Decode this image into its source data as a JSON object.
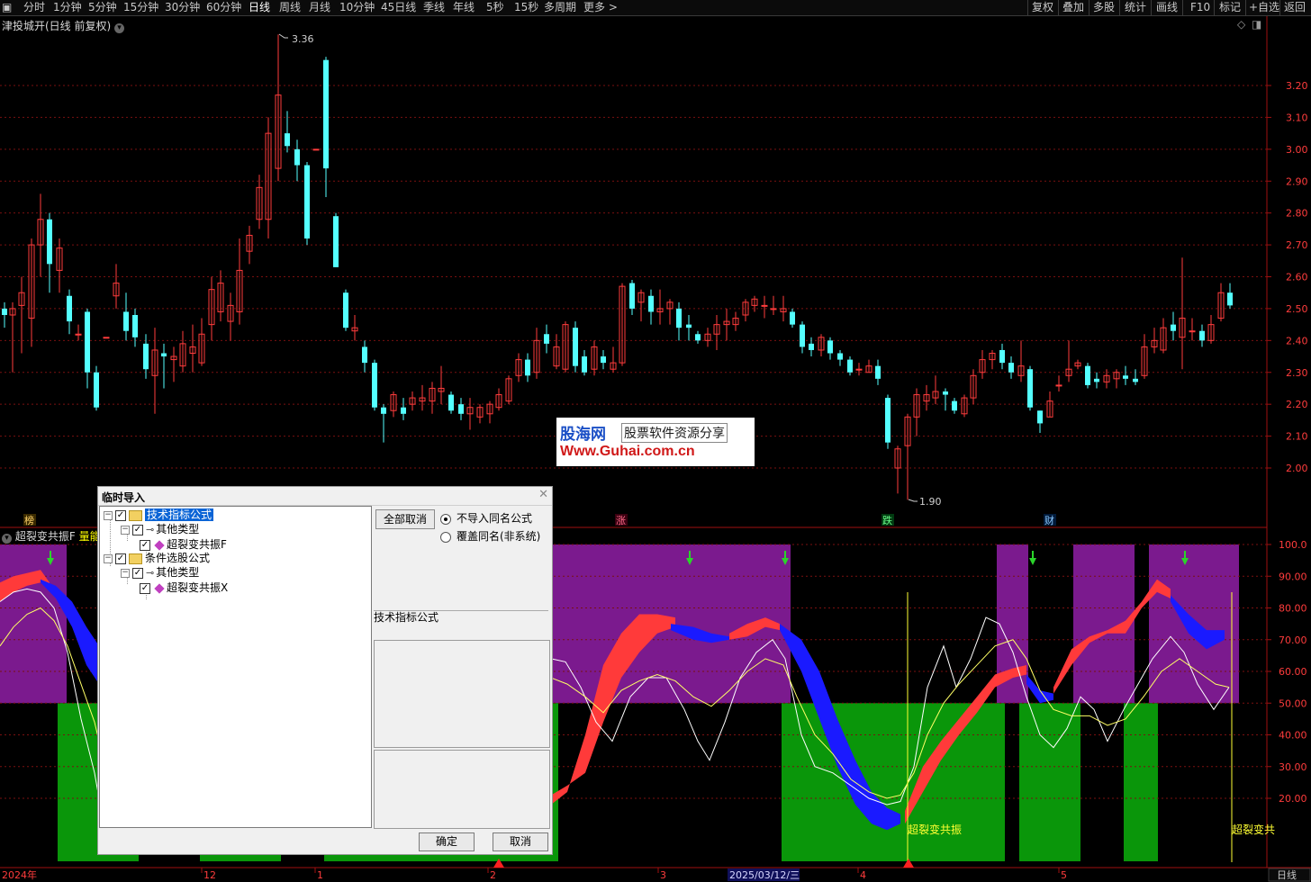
{
  "toolbar": {
    "periods": [
      "分时",
      "1分钟",
      "5分钟",
      "15分钟",
      "30分钟",
      "60分钟",
      "日线",
      "周线",
      "月线",
      "10分钟",
      "45日线",
      "季线",
      "年线",
      "5秒",
      "15秒",
      "多周期",
      "更多 >"
    ],
    "active": "日线",
    "right_buttons": [
      "复权",
      "叠加",
      "多股",
      "统计",
      "画线",
      "F10",
      "标记",
      "+自选",
      "返回"
    ]
  },
  "chart": {
    "title": "津投城开(日线 前复权)",
    "high_label": "3.36",
    "low_label": "1.90",
    "price_ticks": [
      "3.20",
      "3.10",
      "3.00",
      "2.90",
      "2.80",
      "2.70",
      "2.60",
      "2.50",
      "2.40",
      "2.30",
      "2.20",
      "2.10",
      "2.00"
    ],
    "event_labels": [
      "榜",
      "涨",
      "跌",
      "财"
    ],
    "colors": {
      "up": "#ff3c3c",
      "down": "#54ffff",
      "axis": "#ff3c3c"
    }
  },
  "indicator": {
    "title": "超裂变共振F",
    "title_suffix": "量能",
    "ticks": [
      "100.0",
      "90.00",
      "80.00",
      "70.00",
      "60.00",
      "50.00",
      "40.00",
      "30.00",
      "20.00"
    ],
    "signal_label_1": "超裂变共振",
    "signal_label_2": "超裂变共"
  },
  "timeline": {
    "labels": [
      "2024年",
      "12",
      "1",
      "2",
      "3",
      "2025/03/12/三",
      "4",
      "5"
    ],
    "period": "日线"
  },
  "watermark": {
    "brand": "股海网",
    "slogan": "股票软件资源分享",
    "url": "Www.Guhai.com.cn"
  },
  "dialog": {
    "title": "临时导入",
    "tree": {
      "tech_formula": "技术指标公式",
      "other_type_1": "其他类型",
      "formula_f": "超裂变共振F",
      "condition_formula": "条件选股公式",
      "other_type_2": "其他类型",
      "formula_x": "超裂变共振X"
    },
    "cancel_all": "全部取消",
    "radio_no_import": "不导入同名公式",
    "radio_overwrite": "覆盖同名(非系统)",
    "type_label": "技术指标公式",
    "ok": "确定",
    "cancel": "取消"
  }
}
